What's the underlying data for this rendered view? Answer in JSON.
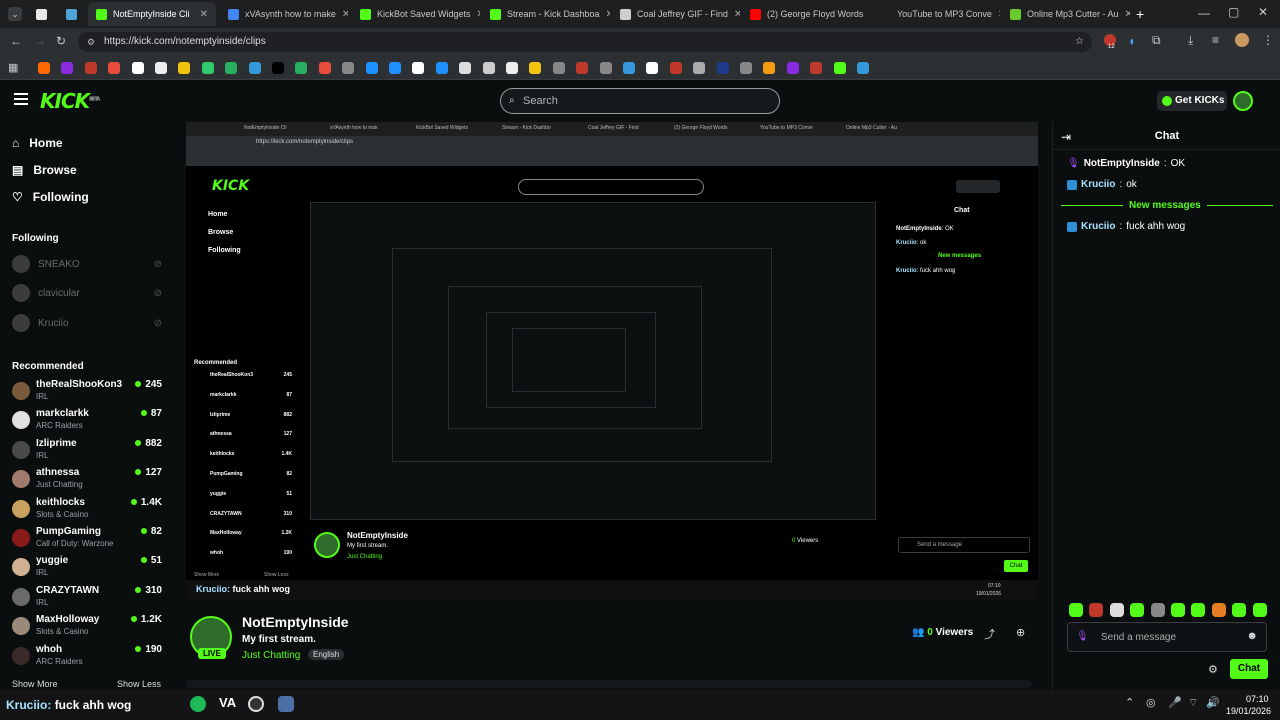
{
  "browser": {
    "tabs": [
      {
        "title": "",
        "color": "#2d3033"
      },
      {
        "title": "",
        "color": "#2d3033"
      },
      {
        "title": "NotEmptyInside Cli",
        "color": "#53fc18",
        "active": true
      },
      {
        "title": "xVAsynth how to make",
        "color": "#4285f4"
      },
      {
        "title": "KickBot Saved Widgets",
        "color": "#53fc18"
      },
      {
        "title": "Stream - Kick Dashboa",
        "color": "#53fc18"
      },
      {
        "title": "Coal Jeffrey GIF - Find",
        "color": "#cfcfcf"
      },
      {
        "title": "(2) George Floyd Words",
        "color": "#ff0000"
      },
      {
        "title": "YouTube to MP3 Conve",
        "color": "#1e1e1e"
      },
      {
        "title": "Online Mp3 Cutter - Au",
        "color": "#6bcb2e"
      }
    ],
    "url": "https://kick.com/notemptyinside/clips",
    "extension_badge": "12"
  },
  "header": {
    "logo": "KICK",
    "logo_beta": "BETA",
    "search_placeholder": "Search",
    "get_kicks": "Get KICKs"
  },
  "sidebar": {
    "nav": [
      {
        "label": "Home",
        "icon": "home-icon"
      },
      {
        "label": "Browse",
        "icon": "browse-icon"
      },
      {
        "label": "Following",
        "icon": "heart-icon"
      }
    ],
    "following_title": "Following",
    "following": [
      "SNEAKO",
      "clavicular",
      "Kruciio"
    ],
    "recommended_title": "Recommended",
    "recommended": [
      {
        "name": "theRealShooKon3",
        "category": "IRL",
        "viewers": "245",
        "color": "#7a5a3a"
      },
      {
        "name": "markclarkk",
        "category": "ARC Raiders",
        "viewers": "87",
        "color": "#e0e0e0"
      },
      {
        "name": "Izliprime",
        "category": "IRL",
        "viewers": "882",
        "color": "#4a4a4a"
      },
      {
        "name": "athnessa",
        "category": "Just Chatting",
        "viewers": "127",
        "color": "#a07a6a"
      },
      {
        "name": "keithlocks",
        "category": "Slots & Casino",
        "viewers": "1.4K",
        "color": "#c8a060"
      },
      {
        "name": "PumpGaming",
        "category": "Call of Duty: Warzone",
        "viewers": "82",
        "color": "#8a1a1a"
      },
      {
        "name": "yuggie",
        "category": "IRL",
        "viewers": "51",
        "color": "#d0b090"
      },
      {
        "name": "CRAZYTAWN",
        "category": "IRL",
        "viewers": "310",
        "color": "#6a6a6a"
      },
      {
        "name": "MaxHolloway",
        "category": "Slots & Casino",
        "viewers": "1.2K",
        "color": "#9a8a7a"
      },
      {
        "name": "whoh",
        "category": "ARC Raiders",
        "viewers": "190",
        "color": "#3a2a2a"
      }
    ],
    "show_more": "Show More",
    "show_less": "Show Less"
  },
  "stream": {
    "channel": "NotEmptyInside",
    "title": "My first stream.",
    "category": "Just Chatting",
    "tag": "English",
    "live_label": "LIVE",
    "viewers": "0",
    "viewers_label": "Viewers"
  },
  "overlay": {
    "user": "Kruciio:",
    "message": "fuck ahh wog"
  },
  "chat": {
    "title": "Chat",
    "messages": [
      {
        "user": "NotEmptyInside",
        "text": "OK",
        "user_color": "#ffffff",
        "badge": "mic-badge-icon"
      },
      {
        "user": "Kruciio",
        "text": "ok",
        "user_color": "#a6e3ff",
        "badge": "kick-badge-icon"
      }
    ],
    "new_messages_label": "New messages",
    "new_messages": [
      {
        "user": "Kruciio",
        "text": "fuck ahh wog",
        "user_color": "#a6e3ff",
        "badge": "kick-badge-icon"
      }
    ],
    "input_placeholder": "Send a message",
    "send_label": "Chat"
  },
  "taskbar": {
    "time": "07:10",
    "date": "19/01/2026",
    "va_label": "VA"
  },
  "inner_video": {
    "url": "https://kick.com/notemptyinside/clips",
    "chat_title": "Chat",
    "new_messages_label": "New messages",
    "send_placeholder": "Send a message",
    "send_label": "Chat",
    "viewers": "0",
    "viewers_label": "Viewers",
    "home": "Home",
    "browse": "Browse",
    "following": "Following",
    "recommended": "Recommended",
    "show_more": "Show More",
    "show_less": "Show Less",
    "time": "07:10",
    "date": "19/01/2026",
    "tabs": [
      "NotEmptyInside Cli",
      "xVAsynth how to mak",
      "KickBot Saved Widgets",
      "Stream - Kick Dashbo",
      "Coal Jeffrey GIF - Find",
      "(2) George Floyd Words",
      "YouTube to MP3 Conve",
      "Online Mp3 Cutter - Au"
    ]
  }
}
